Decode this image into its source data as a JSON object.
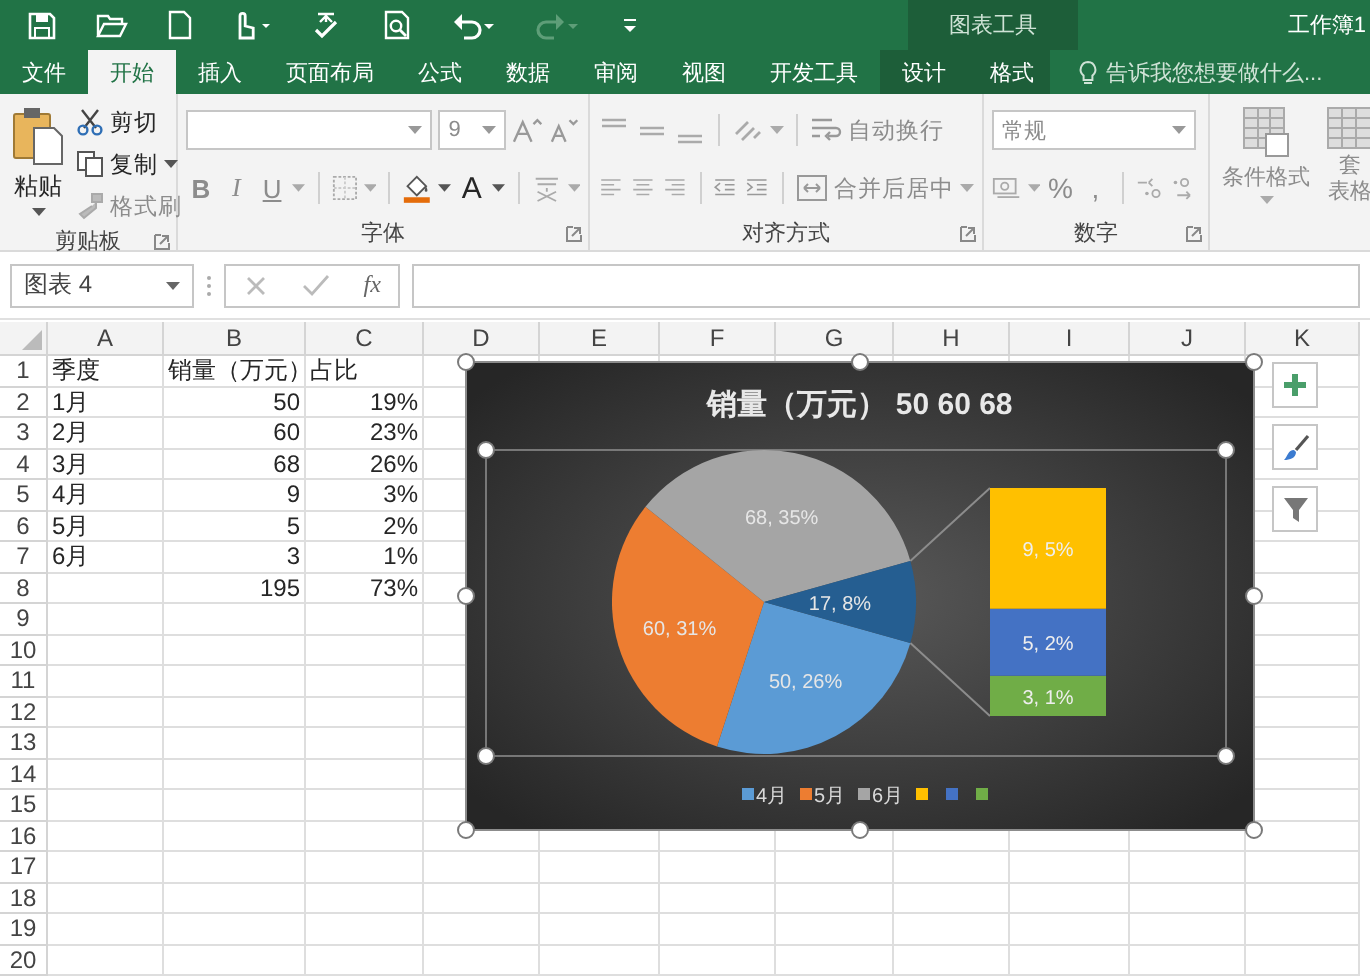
{
  "window": {
    "title": "工作簿1"
  },
  "tabs": [
    {
      "label": "文件",
      "selected": false
    },
    {
      "label": "开始",
      "selected": true
    },
    {
      "label": "插入",
      "selected": false
    },
    {
      "label": "页面布局",
      "selected": false
    },
    {
      "label": "公式",
      "selected": false
    },
    {
      "label": "数据",
      "selected": false
    },
    {
      "label": "审阅",
      "selected": false
    },
    {
      "label": "视图",
      "selected": false
    },
    {
      "label": "开发工具",
      "selected": false
    }
  ],
  "contextual_tabs": {
    "title": "图表工具",
    "tabs": [
      {
        "label": "设计",
        "selected": false
      },
      {
        "label": "格式",
        "selected": false
      }
    ]
  },
  "tell_me": {
    "placeholder": "告诉我您想要做什么..."
  },
  "ribbon": {
    "clipboard": {
      "label": "剪贴板",
      "paste": "粘贴",
      "cut": {
        "label": "剪切",
        "disabled": false
      },
      "copy": {
        "label": "复制",
        "disabled": false
      },
      "format_painter": {
        "label": "格式刷",
        "disabled": true
      }
    },
    "font": {
      "label": "字体",
      "font_size": "9",
      "bold": {
        "label": "B",
        "disabled": true
      },
      "italic": {
        "label": "I",
        "disabled": true
      },
      "underline": {
        "label": "U",
        "disabled": true
      },
      "font_color": {
        "label": "A",
        "disabled": false
      }
    },
    "alignment": {
      "label": "对齐方式",
      "wrap_text": {
        "label": "自动换行",
        "disabled": true
      },
      "merge_center": {
        "label": "合并后居中",
        "disabled": true
      }
    },
    "number": {
      "label": "数字",
      "format": "常规",
      "percent": {
        "label": "%",
        "disabled": true
      },
      "comma": {
        "label": ",",
        "disabled": true
      }
    },
    "styles": {
      "conditional_format": {
        "label": "条件格式",
        "disabled": true
      },
      "table_format": {
        "lines": [
          "套",
          "表格"
        ],
        "disabled": true
      }
    }
  },
  "formula_bar": {
    "name_box": "图表 4",
    "function_label": "fx"
  },
  "sheet": {
    "columns": [
      "A",
      "B",
      "C",
      "D",
      "E",
      "F",
      "G",
      "H",
      "I",
      "J",
      "K"
    ],
    "rows": [
      {
        "number": "1",
        "kind": "header",
        "cells": {
          "A": "季度",
          "B": "销量（万元）",
          "C": "占比"
        }
      },
      {
        "number": "2",
        "kind": "data",
        "cells": {
          "A": "1月",
          "B": "50",
          "C": "19%"
        }
      },
      {
        "number": "3",
        "kind": "data",
        "cells": {
          "A": "2月",
          "B": "60",
          "C": "23%"
        }
      },
      {
        "number": "4",
        "kind": "data",
        "cells": {
          "A": "3月",
          "B": "68",
          "C": "26%"
        }
      },
      {
        "number": "5",
        "kind": "data",
        "cells": {
          "A": "4月",
          "B": "9",
          "C": "3%"
        }
      },
      {
        "number": "6",
        "kind": "data",
        "cells": {
          "A": "5月",
          "B": "5",
          "C": "2%"
        }
      },
      {
        "number": "7",
        "kind": "data",
        "cells": {
          "A": "6月",
          "B": "3",
          "C": "1%"
        }
      },
      {
        "number": "8",
        "kind": "data",
        "cells": {
          "B": "195",
          "C": "73%"
        }
      },
      {
        "number": "9"
      },
      {
        "number": "10"
      },
      {
        "number": "11"
      },
      {
        "number": "12"
      },
      {
        "number": "13"
      },
      {
        "number": "14"
      },
      {
        "number": "15"
      },
      {
        "number": "16"
      },
      {
        "number": "17"
      },
      {
        "number": "18"
      },
      {
        "number": "19"
      },
      {
        "number": "20"
      }
    ]
  },
  "chart": {
    "chart_data": {
      "type": "pie",
      "title": "销量（万元） 50 60 68",
      "values": [
        50,
        60,
        68,
        17
      ],
      "value_labels": [
        "50, 26%",
        "60, 31%",
        "68, 35%",
        "17, 8%"
      ]
    },
    "breakout": {
      "chart_data": {
        "type": "bar",
        "stacked": true,
        "categories": [
          null
        ],
        "series": [
          {
            "color": "#70ad47",
            "values": [
              3
            ],
            "value_labels": [
              "3, 1%"
            ]
          },
          {
            "color": "#4472c4",
            "values": [
              5
            ],
            "value_labels": [
              "5, 2%"
            ]
          },
          {
            "color": "#ffc000",
            "values": [
              9
            ],
            "value_labels": [
              "9, 5%"
            ]
          }
        ]
      }
    },
    "points": [
      {
        "kind": "primary",
        "color": "#5b9bd5"
      },
      {
        "kind": "primary",
        "color": "#ed7d31"
      },
      {
        "kind": "primary",
        "color": "#a5a5a5"
      },
      {
        "kind": "other",
        "color": "#255e91"
      }
    ],
    "legend": [
      {
        "label": "4月",
        "color": "#5b9bd5"
      },
      {
        "label": "5月",
        "color": "#ed7d31"
      },
      {
        "label": "6月",
        "color": "#a5a5a5"
      },
      {
        "color": "#ffc000"
      },
      {
        "color": "#4472c4"
      },
      {
        "color": "#70ad47"
      }
    ]
  }
}
